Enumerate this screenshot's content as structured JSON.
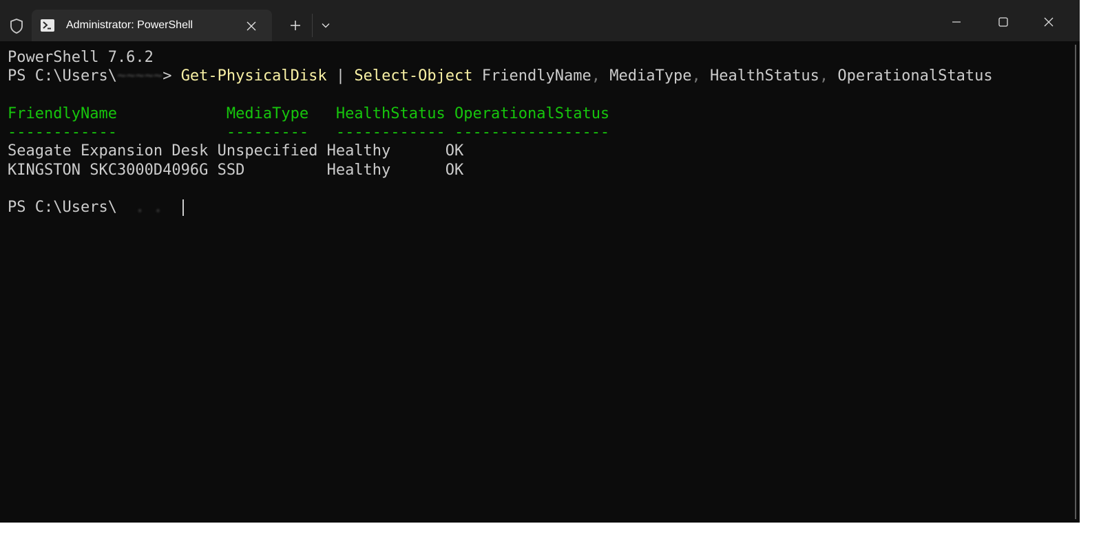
{
  "window": {
    "tab_title": "Administrator: PowerShell",
    "icons": {
      "shield": "shield-icon",
      "tab": "powershell-icon",
      "tab_close": "close-icon",
      "new_tab": "plus-icon",
      "dropdown": "chevron-down-icon",
      "minimize": "minimize-icon",
      "maximize": "maximize-icon",
      "close": "close-icon"
    }
  },
  "terminal": {
    "version_line": "PowerShell 7.6.2",
    "prompt_path": "PS C:\\Users\\",
    "prompt_gt": ">",
    "command": {
      "cmd1": "Get-PhysicalDisk",
      "pipe": "|",
      "cmd2": "Select-Object",
      "arg1": "FriendlyName",
      "arg2": "MediaType",
      "arg3": "HealthStatus",
      "arg4": "OperationalStatus",
      "comma": ","
    },
    "table": {
      "header_line": "FriendlyName            MediaType   HealthStatus OperationalStatus",
      "underline_line": "------------            ---------   ------------ -----------------",
      "rows": [
        "Seagate Expansion Desk Unspecified Healthy      OK",
        "KINGSTON SKC3000D4096G SSD         Healthy      OK"
      ]
    },
    "final_prompt": "PS C:\\Users\\"
  },
  "colors": {
    "background": "#0c0c0c",
    "titlebar": "#202020",
    "tab": "#2b2b2b",
    "text": "#cccccc",
    "command": "#f9f1a5",
    "header": "#16c60c"
  }
}
